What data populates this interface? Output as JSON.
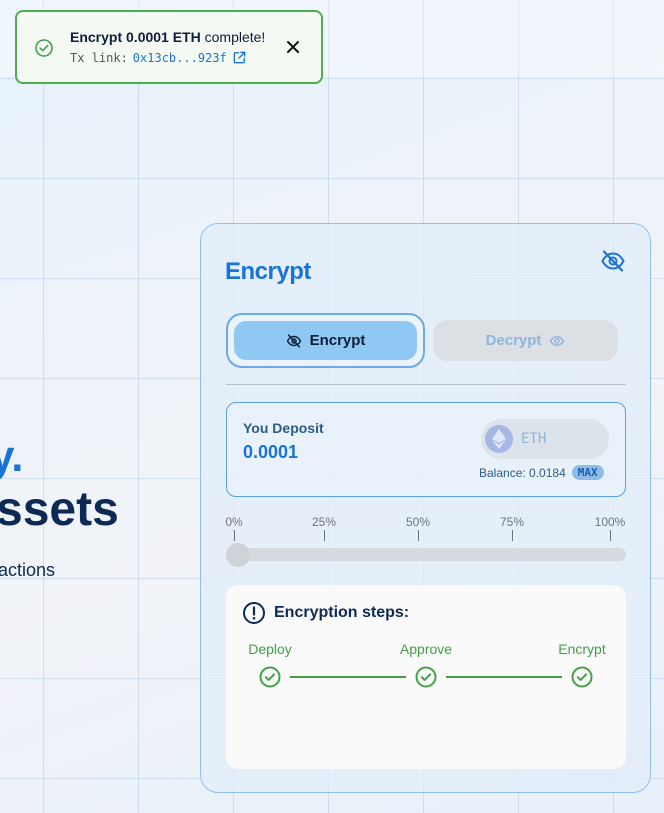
{
  "toast": {
    "title_bold": "Encrypt 0.0001 ETH",
    "title_rest": " complete!",
    "link_label": "Tx link:",
    "link_hash": "0x13cb...923f"
  },
  "hero": {
    "line1": "y.",
    "line2": "ssets",
    "subtitle": "actions"
  },
  "card": {
    "title": "Encrypt",
    "tabs": {
      "encrypt": "Encrypt",
      "decrypt": "Decrypt"
    },
    "deposit": {
      "label": "You Deposit",
      "value": "0.0001",
      "token": "ETH",
      "balance": "Balance: 0.0184",
      "max": "MAX"
    },
    "slider": {
      "ticks": [
        "0%",
        "25%",
        "50%",
        "75%",
        "100%"
      ],
      "value_percent": 0
    },
    "steps": {
      "title": "Encryption steps:",
      "items": [
        "Deploy",
        "Approve",
        "Encrypt"
      ]
    }
  },
  "colors": {
    "accent": "#1a73d9",
    "success": "#43a047",
    "navy": "#0d2a55"
  },
  "icons": [
    "check-circle-icon",
    "external-link-icon",
    "close-icon",
    "eye-off-icon",
    "eye-icon",
    "eth-icon",
    "info-icon"
  ]
}
